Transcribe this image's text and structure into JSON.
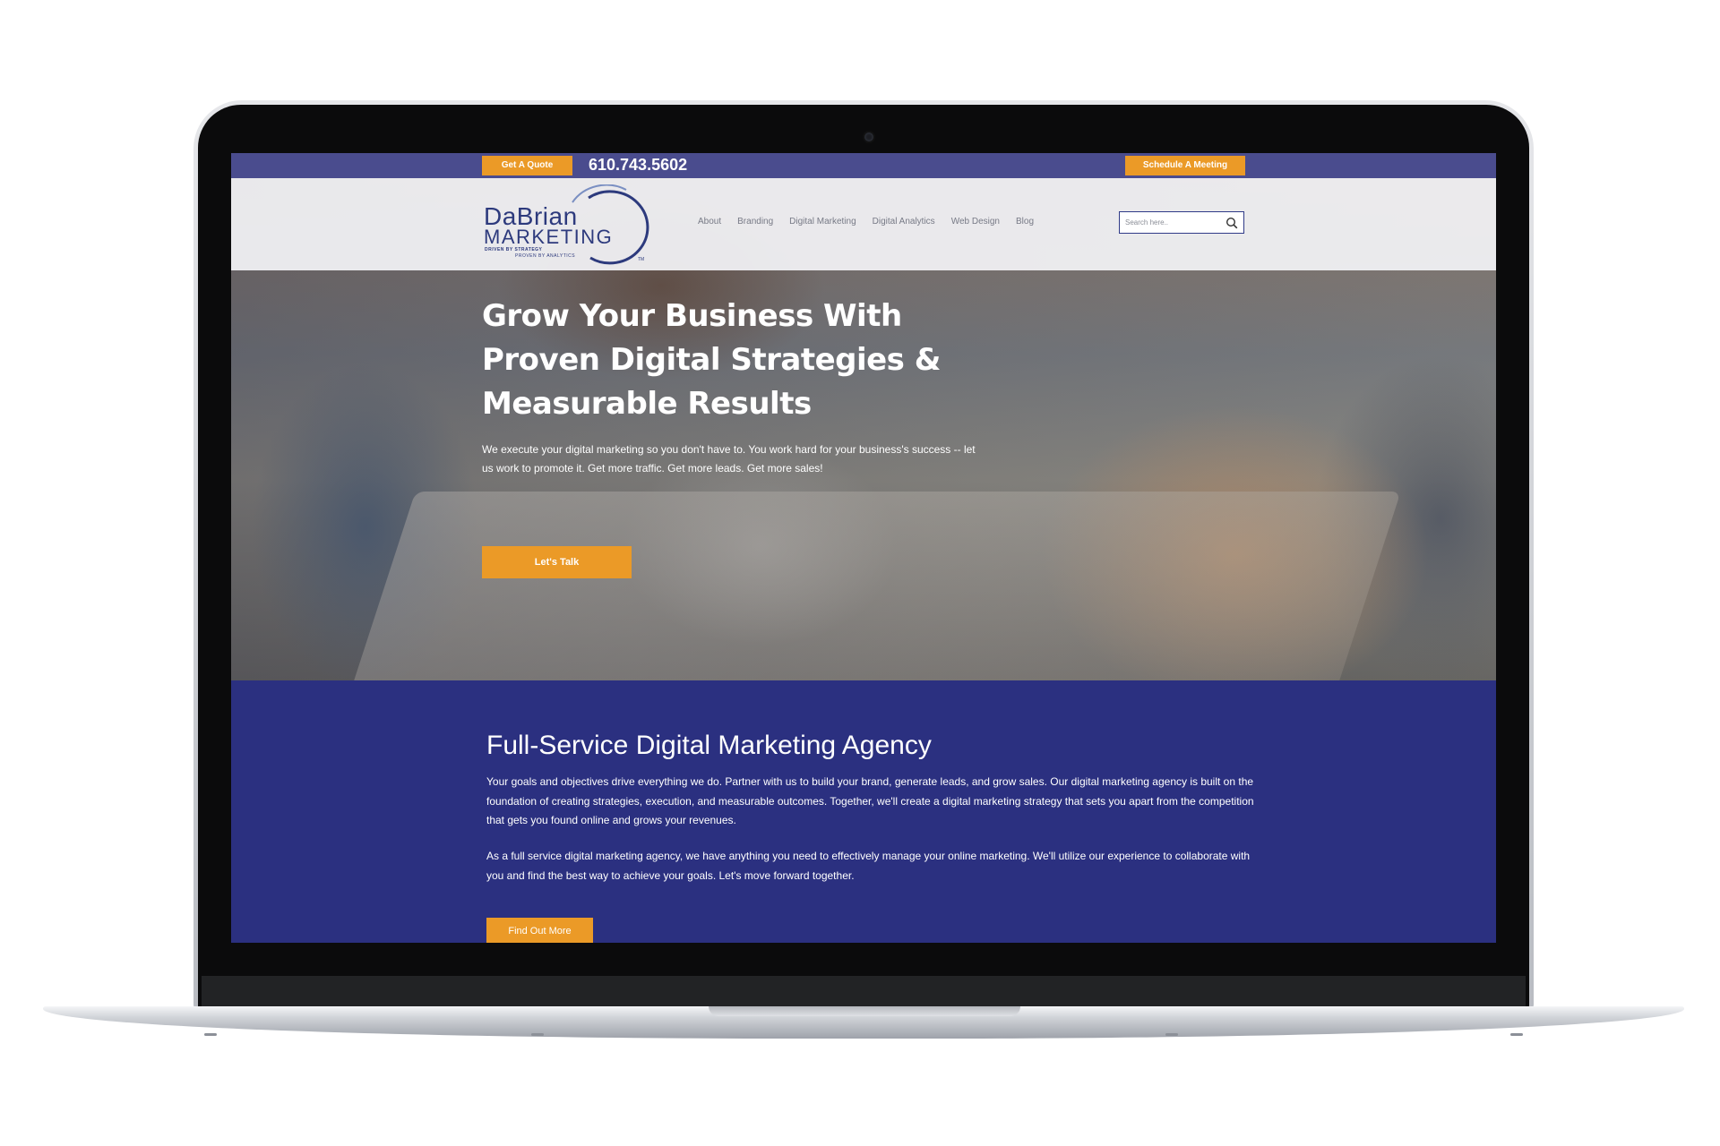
{
  "topbar": {
    "quote_label": "Get A Quote",
    "phone": "610.743.5602",
    "meeting_label": "Schedule A Meeting"
  },
  "logo": {
    "line1": "DaBrian",
    "line2": "MARKETING",
    "tagline1": "DRIVEN BY STRATEGY",
    "tagline2": "PROVEN BY ANALYTICS",
    "tm": "TM"
  },
  "nav": {
    "items": [
      {
        "label": "About"
      },
      {
        "label": "Branding"
      },
      {
        "label": "Digital Marketing"
      },
      {
        "label": "Digital Analytics"
      },
      {
        "label": "Web Design"
      },
      {
        "label": "Blog"
      }
    ],
    "search_placeholder": "Search here.."
  },
  "hero": {
    "title_line1": "Grow Your Business With",
    "title_line2": "Proven Digital Strategies &",
    "title_line3": "Measurable Results",
    "text": "We execute your digital marketing so you don't have to. You work hard for your business's success -- let us work to promote it. Get more traffic. Get more leads. Get more sales!",
    "cta_label": "Let's Talk"
  },
  "service": {
    "title": "Full-Service Digital Marketing Agency",
    "p1": "Your goals and objectives drive everything we do. Partner with us to build your brand, generate leads, and grow sales. Our digital marketing agency is built on the foundation of creating strategies, execution, and measurable outcomes. Together, we'll create a digital marketing strategy that sets you apart from the competition that gets you found online and grows your revenues.",
    "p2": "As a full service digital marketing agency, we have anything you need to effectively manage your online marketing. We'll utilize our experience to collaborate with you and find the best way to achieve your goals. Let's move forward together.",
    "cta_label": "Find Out More"
  },
  "colors": {
    "brand_navy": "#2b3080",
    "topbar": "#4a4c8e",
    "accent_orange": "#eb9a27",
    "logo_blue": "#2d3a7d"
  },
  "icons": {
    "search": "search-icon",
    "camera": "camera-icon"
  }
}
